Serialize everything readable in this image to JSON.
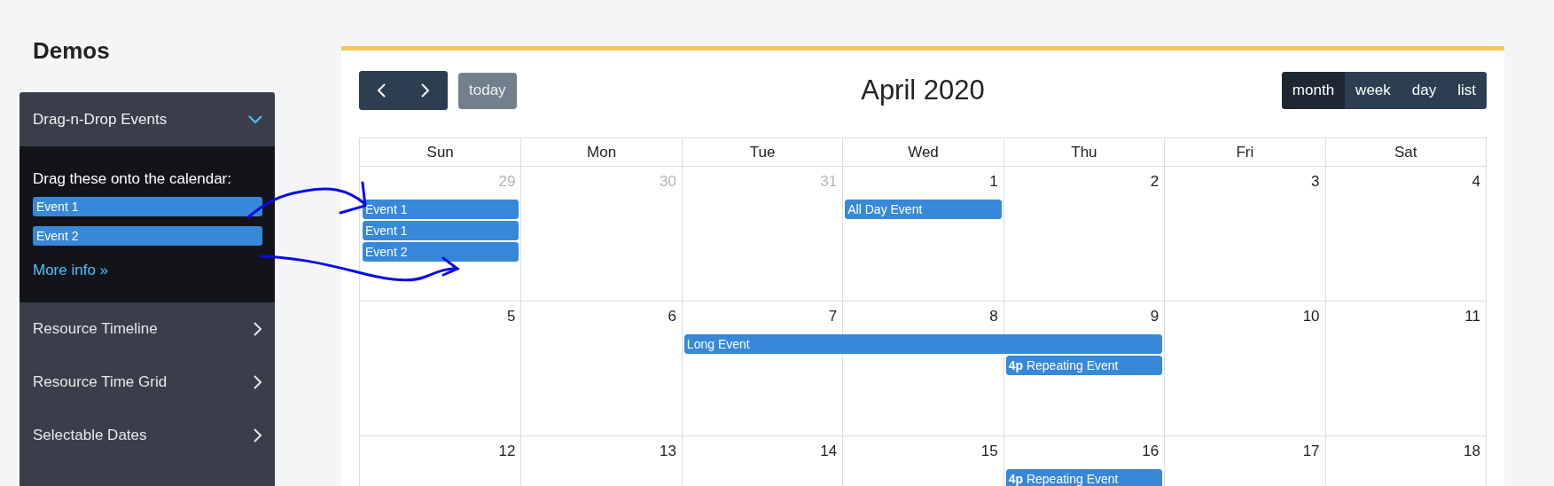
{
  "page": {
    "title": "Demos"
  },
  "sidebar": {
    "sections": [
      {
        "label": "Drag-n-Drop Events",
        "expanded": true,
        "content": {
          "instruction": "Drag these onto the calendar:",
          "draggables": [
            "Event 1",
            "Event 2"
          ],
          "link": "More info »"
        }
      },
      {
        "label": "Resource Timeline",
        "expanded": false
      },
      {
        "label": "Resource Time Grid",
        "expanded": false
      },
      {
        "label": "Selectable Dates",
        "expanded": false
      }
    ]
  },
  "calendar": {
    "title": "April 2020",
    "today": {
      "label": "today",
      "disabled": true
    },
    "views": [
      {
        "label": "month",
        "selected": true
      },
      {
        "label": "week",
        "selected": false
      },
      {
        "label": "day",
        "selected": false
      },
      {
        "label": "list",
        "selected": false
      }
    ],
    "weekdays": [
      "Sun",
      "Mon",
      "Tue",
      "Wed",
      "Thu",
      "Fri",
      "Sat"
    ],
    "weeks": [
      {
        "days": [
          {
            "date": "29",
            "other_month": true,
            "events": [
              {
                "kind": "event",
                "title": "Event 1"
              },
              {
                "kind": "event",
                "title": "Event 1"
              },
              {
                "kind": "event",
                "title": "Event 2"
              }
            ]
          },
          {
            "date": "30",
            "other_month": true
          },
          {
            "date": "31",
            "other_month": true
          },
          {
            "date": "1",
            "other_month": false,
            "events": [
              {
                "kind": "event",
                "title": "All Day Event"
              }
            ]
          },
          {
            "date": "2",
            "other_month": false
          },
          {
            "date": "3",
            "other_month": false
          },
          {
            "date": "4",
            "other_month": false
          }
        ]
      },
      {
        "days": [
          {
            "date": "5",
            "other_month": false
          },
          {
            "date": "6",
            "other_month": false
          },
          {
            "date": "7",
            "other_month": false,
            "events": [
              {
                "kind": "event",
                "title": "Long Event"
              }
            ]
          },
          {
            "date": "8",
            "other_month": false,
            "events": [
              {
                "kind": "continuation"
              }
            ]
          },
          {
            "date": "9",
            "other_month": false,
            "events": [
              {
                "kind": "continuation"
              },
              {
                "kind": "event",
                "time": "4p",
                "title": "Repeating Event"
              }
            ]
          },
          {
            "date": "10",
            "other_month": false
          },
          {
            "date": "11",
            "other_month": false
          }
        ]
      },
      {
        "days": [
          {
            "date": "12",
            "other_month": false
          },
          {
            "date": "13",
            "other_month": false
          },
          {
            "date": "14",
            "other_month": false
          },
          {
            "date": "15",
            "other_month": false
          },
          {
            "date": "16",
            "other_month": false,
            "events": [
              {
                "kind": "event",
                "time": "4p",
                "title": "Repeating Event"
              }
            ]
          },
          {
            "date": "17",
            "other_month": false
          },
          {
            "date": "18",
            "other_month": false
          }
        ]
      }
    ]
  }
}
